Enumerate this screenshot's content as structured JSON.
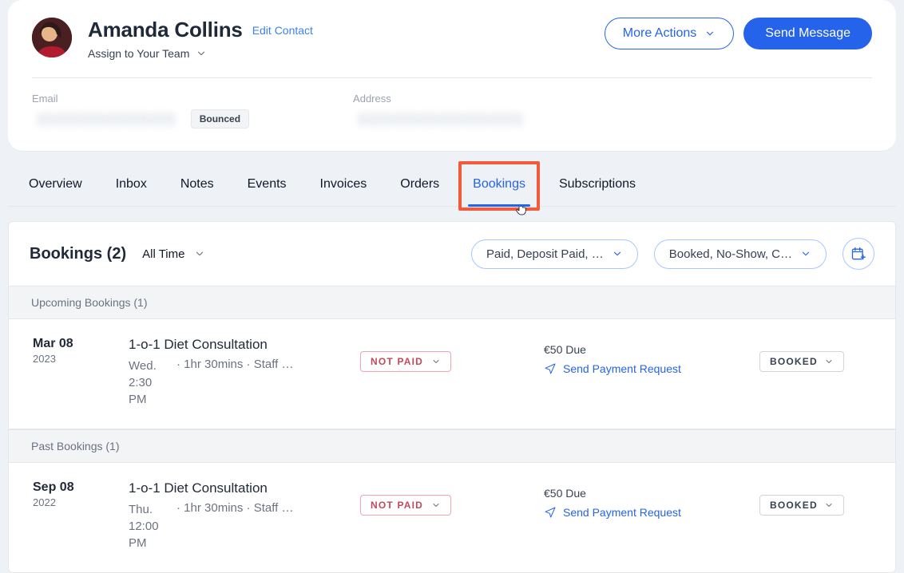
{
  "header": {
    "name": "Amanda Collins",
    "edit_label": "Edit Contact",
    "assign_label": "Assign to Your Team",
    "more_label": "More Actions",
    "send_label": "Send Message"
  },
  "details": {
    "email_label": "Email",
    "email_value": "████████████████",
    "bounced_label": "Bounced",
    "address_label": "Address",
    "address_value": "███████████████████"
  },
  "tabs": [
    "Overview",
    "Inbox",
    "Notes",
    "Events",
    "Invoices",
    "Orders",
    "Bookings",
    "Subscriptions"
  ],
  "tabs_active_index": 6,
  "panel": {
    "title": "Bookings (2)",
    "time_filter": "All Time",
    "paid_filter": "Paid, Deposit Paid, …",
    "status_filter": "Booked, No-Show, C…"
  },
  "sections": [
    {
      "label": "Upcoming Bookings (1)",
      "rows": [
        {
          "date_md": "Mar 08",
          "date_year": "2023",
          "service": "1-o-1 Diet Consultation",
          "daytime": "Wed. 2:30 PM",
          "duration": "· 1hr 30mins · Staff …",
          "pay_status": "NOT PAID",
          "amount_due": "€50 Due",
          "pay_link": "Send Payment Request",
          "book_status": "BOOKED"
        }
      ]
    },
    {
      "label": "Past Bookings (1)",
      "rows": [
        {
          "date_md": "Sep 08",
          "date_year": "2022",
          "service": "1-o-1 Diet Consultation",
          "daytime": "Thu. 12:00 PM",
          "duration": "· 1hr 30mins · Staff …",
          "pay_status": "NOT PAID",
          "amount_due": "€50 Due",
          "pay_link": "Send Payment Request",
          "book_status": "BOOKED"
        }
      ]
    }
  ]
}
